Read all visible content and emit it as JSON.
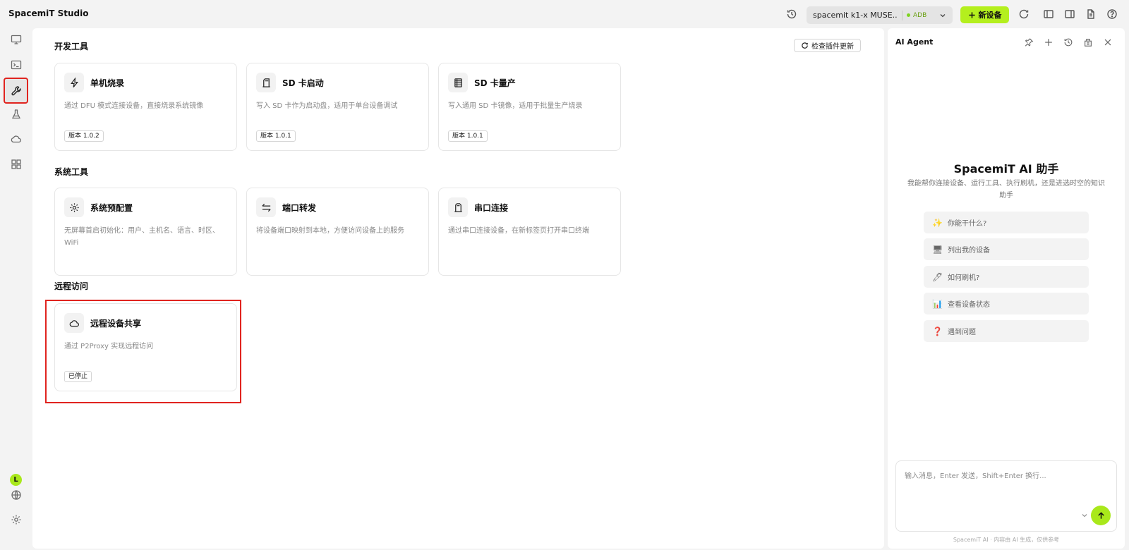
{
  "app": {
    "title": "SpacemiT Studio"
  },
  "titlebar": {
    "device_name": "spacemit k1-x MUSE...",
    "device_badge": "ADB",
    "new_device_label": "新设备",
    "new_device_icon": "plus-icon",
    "icons": [
      "history-icon",
      "refresh-icon",
      "toggle-left-panel-icon",
      "toggle-right-panel-icon",
      "document-icon",
      "help-icon"
    ]
  },
  "rail": {
    "items": [
      "monitor-icon",
      "terminal-icon",
      "wrench-icon",
      "flask-icon",
      "cloud-icon",
      "grid-icon"
    ],
    "active": "wrench-icon",
    "avatar_letter": "L",
    "bottom_icons": [
      "globe-icon",
      "gear-icon"
    ]
  },
  "main": {
    "check_updates_label": "检查插件更新",
    "sections": [
      {
        "title": "开发工具",
        "cards": [
          {
            "icon": "lightning-icon",
            "title": "单机烧录",
            "desc": "通过 DFU 模式连接设备，直接烧录系统镜像",
            "badge": "版本 1.0.2"
          },
          {
            "icon": "sd-card-icon",
            "title": "SD 卡启动",
            "desc": "写入 SD 卡作为启动盘，适用于单台设备调试",
            "badge": "版本 1.0.1"
          },
          {
            "icon": "sd-stack-icon",
            "title": "SD 卡量产",
            "desc": "写入通用 SD 卡镜像，适用于批量生产烧录",
            "badge": "版本 1.0.1"
          }
        ]
      },
      {
        "title": "系统工具",
        "cards": [
          {
            "icon": "gear-icon",
            "title": "系统预配置",
            "desc": "无屏幕首启初始化：用户、主机名、语言、时区、WiFi"
          },
          {
            "icon": "swap-arrows-icon",
            "title": "端口转发",
            "desc": "将设备端口映射到本地，方便访问设备上的服务"
          },
          {
            "icon": "serial-port-icon",
            "title": "串口连接",
            "desc": "通过串口连接设备，在新标签页打开串口终端"
          }
        ]
      },
      {
        "title": "远程访问",
        "cards": [
          {
            "icon": "cloud-icon",
            "title": "远程设备共享",
            "desc": "通过 P2Proxy 实现远程访问",
            "badge": "已停止"
          }
        ]
      }
    ]
  },
  "agent": {
    "title": "AI Agent",
    "header_icons": [
      "pin-icon",
      "plus-icon",
      "history-icon",
      "clear-icon",
      "close-icon"
    ],
    "heading": "SpacemiT AI 助手",
    "subtitle": "我能帮你连接设备、运行工具、执行刷机，还是进选时空的知识助手",
    "suggestions": [
      {
        "emoji": "✨",
        "label": "你能干什么?"
      },
      {
        "emoji": "🖥",
        "label": "列出我的设备"
      },
      {
        "emoji": "🖊",
        "label": "如何刷机?"
      },
      {
        "emoji": "📊",
        "label": "查看设备状态"
      },
      {
        "emoji": "❓",
        "label": "遇到问题"
      }
    ],
    "input_placeholder": "输入消息，Enter 发送，Shift+Enter 换行...",
    "footer": "SpacemiT AI · 内容由 AI 生成，仅供参考"
  }
}
